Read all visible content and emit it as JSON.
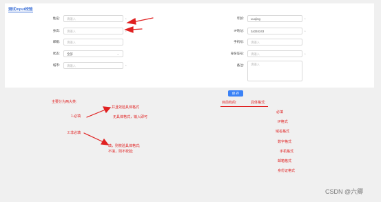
{
  "page": {
    "title": "测试input校验"
  },
  "form": {
    "left": [
      {
        "label": "姓名:",
        "placeholder": "请输入",
        "value": ""
      },
      {
        "label": "身高:",
        "placeholder": "请输入",
        "value": ""
      },
      {
        "label": "邮箱:",
        "placeholder": "请输入",
        "value": ""
      },
      {
        "label": "状态:",
        "placeholder": "",
        "value": "全部"
      },
      {
        "label": "城市:",
        "placeholder": "请输入",
        "value": ""
      }
    ],
    "right": [
      {
        "label": "年龄:",
        "placeholder": "",
        "value": "Luojing"
      },
      {
        "label": "IP地址:",
        "placeholder": "",
        "value": "2a334243"
      },
      {
        "label": "手机号:",
        "placeholder": "请输入",
        "value": ""
      },
      {
        "label": "身份证号:",
        "placeholder": "请输入",
        "value": ""
      },
      {
        "label": "备注:",
        "placeholder": "请输入",
        "value": ""
      }
    ],
    "required_mark": "*",
    "save_label": "保 存"
  },
  "annotations": {
    "main_title": "主要分为两大类:",
    "item1": "1.必填",
    "item1_detail_a": "并且效验具体格式",
    "item1_detail_b": "无具体格式，输入即可",
    "item2": "2.非必填",
    "item2_detail_a": "填，则校验具体格式;",
    "item2_detail_b": "不填，则不校验;",
    "existing_label": "目前有的:",
    "formats_label": "具体格式:",
    "formats": [
      "必填",
      "IP格式",
      "域名格式",
      "数字格式",
      "手机格式",
      "邮箱格式",
      "身份证格式"
    ]
  },
  "watermark": "CSDN @六卿",
  "colors": {
    "accent": "#3b6fd6",
    "button": "#3b82f6",
    "annotation": "#e02020"
  }
}
